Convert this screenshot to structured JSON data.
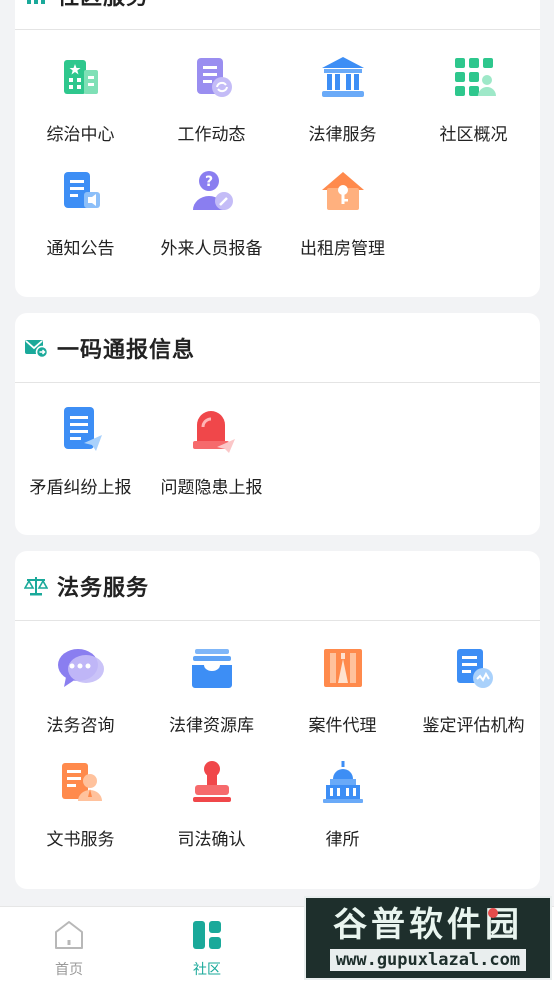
{
  "sections": {
    "community": {
      "title": "社区服务",
      "items": [
        {
          "label": "综治中心",
          "icon": "building-icon"
        },
        {
          "label": "工作动态",
          "icon": "document-refresh-icon"
        },
        {
          "label": "法律服务",
          "icon": "courthouse-icon"
        },
        {
          "label": "社区概况",
          "icon": "grid-person-icon"
        },
        {
          "label": "通知公告",
          "icon": "notice-speaker-icon"
        },
        {
          "label": "外来人员报备",
          "icon": "person-question-icon"
        },
        {
          "label": "出租房管理",
          "icon": "house-key-icon"
        }
      ]
    },
    "report": {
      "title": "一码通报信息",
      "items": [
        {
          "label": "矛盾纠纷上报",
          "icon": "list-send-icon"
        },
        {
          "label": "问题隐患上报",
          "icon": "alarm-light-icon"
        }
      ]
    },
    "legal": {
      "title": "法务服务",
      "items": [
        {
          "label": "法务咨询",
          "icon": "chat-bubble-icon"
        },
        {
          "label": "法律资源库",
          "icon": "inbox-tray-icon"
        },
        {
          "label": "案件代理",
          "icon": "case-door-icon"
        },
        {
          "label": "鉴定评估机构",
          "icon": "certificate-icon"
        },
        {
          "label": "文书服务",
          "icon": "document-person-icon"
        },
        {
          "label": "司法确认",
          "icon": "seal-stamp-icon"
        },
        {
          "label": "律所",
          "icon": "capitol-building-icon"
        }
      ]
    }
  },
  "tabbar": {
    "home": "首页",
    "community": "社区"
  },
  "watermark": {
    "brand": "谷普软件园",
    "url": "www.gupuxlazal.com"
  },
  "colors": {
    "accent": "#1aa99a",
    "inactive": "#9a9a9a"
  }
}
